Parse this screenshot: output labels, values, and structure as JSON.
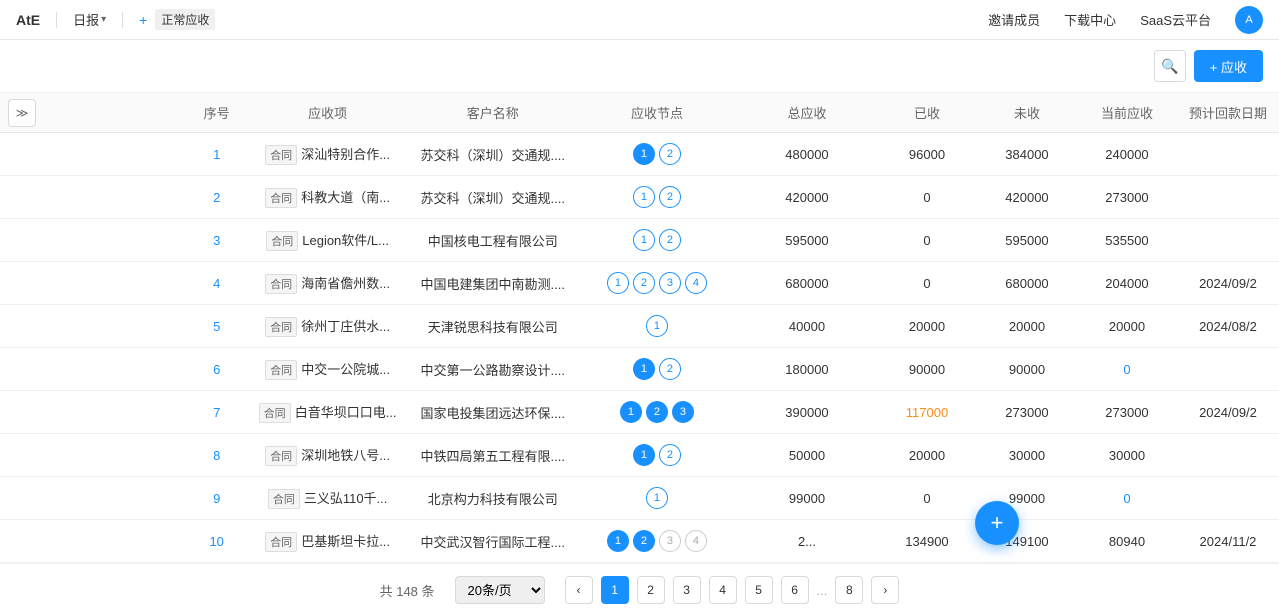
{
  "header": {
    "logo": "AtE",
    "daily_label": "日报",
    "daily_arrow": "▾",
    "plus": "+",
    "normal_receivable": "正常应收",
    "invite": "邀请成员",
    "download": "下载中心",
    "saas": "SaaS云平台"
  },
  "toolbar": {
    "add_label": "+ 应收"
  },
  "table": {
    "columns": [
      "序号",
      "应收项",
      "客户名称",
      "应收节点",
      "总应收",
      "已收",
      "未收",
      "当前应收",
      "预计回款日期"
    ],
    "rows": [
      {
        "seq": "1",
        "type": "合同",
        "item": "深汕特别合作...",
        "client": "苏交科（深圳）交通规....",
        "nodes": [
          {
            "n": 1,
            "filled": true
          },
          {
            "n": 2,
            "filled": false
          }
        ],
        "total": "480000",
        "paid": "96000",
        "unpaid": "384000",
        "current": "240000",
        "date": ""
      },
      {
        "seq": "2",
        "type": "合同",
        "item": "科教大道（南...",
        "client": "苏交科（深圳）交通规....",
        "nodes": [
          {
            "n": 1,
            "filled": false
          },
          {
            "n": 2,
            "filled": false
          }
        ],
        "total": "420000",
        "paid": "0",
        "unpaid": "420000",
        "current": "273000",
        "date": ""
      },
      {
        "seq": "3",
        "type": "合同",
        "item": "Legion软件/L...",
        "client": "中国核电工程有限公司",
        "nodes": [
          {
            "n": 1,
            "filled": false
          },
          {
            "n": 2,
            "filled": false
          }
        ],
        "total": "595000",
        "paid": "0",
        "unpaid": "595000",
        "current": "535500",
        "date": ""
      },
      {
        "seq": "4",
        "type": "合同",
        "item": "海南省儋州数...",
        "client": "中国电建集团中南勘测....",
        "nodes": [
          {
            "n": 1,
            "filled": false
          },
          {
            "n": 2,
            "filled": false
          },
          {
            "n": 3,
            "filled": false
          },
          {
            "n": 4,
            "filled": false
          }
        ],
        "total": "680000",
        "paid": "0",
        "unpaid": "680000",
        "current": "204000",
        "date": "2024/09/2"
      },
      {
        "seq": "5",
        "type": "合同",
        "item": "徐州丁庄供水...",
        "client": "天津锐思科技有限公司",
        "nodes": [
          {
            "n": 1,
            "filled": false
          }
        ],
        "total": "40000",
        "paid": "20000",
        "unpaid": "20000",
        "current": "20000",
        "date": "2024/08/2"
      },
      {
        "seq": "6",
        "type": "合同",
        "item": "中交一公院城...",
        "client": "中交第一公路勘察设计....",
        "nodes": [
          {
            "n": 1,
            "filled": true
          },
          {
            "n": 2,
            "filled": false
          }
        ],
        "total": "180000",
        "paid": "90000",
        "unpaid": "90000",
        "current": "0",
        "date": "",
        "current_special": true
      },
      {
        "seq": "7",
        "type": "合同",
        "item": "白音华坝口口电...",
        "client": "国家电投集团远达环保....",
        "nodes": [
          {
            "n": 1,
            "filled": true
          },
          {
            "n": 2,
            "filled": true
          },
          {
            "n": 3,
            "filled": true
          }
        ],
        "total": "390000",
        "paid": "117000",
        "unpaid": "273000",
        "current": "273000",
        "date": "2024/09/2",
        "paid_special": true
      },
      {
        "seq": "8",
        "type": "合同",
        "item": "深圳地铁八号...",
        "client": "中铁四局第五工程有限....",
        "nodes": [
          {
            "n": 1,
            "filled": true
          },
          {
            "n": 2,
            "filled": false
          }
        ],
        "total": "50000",
        "paid": "20000",
        "unpaid": "30000",
        "current": "30000",
        "date": ""
      },
      {
        "seq": "9",
        "type": "合同",
        "item": "三义弘110千...",
        "client": "北京构力科技有限公司",
        "nodes": [
          {
            "n": 1,
            "filled": false
          }
        ],
        "total": "99000",
        "paid": "0",
        "unpaid": "99000",
        "current": "0",
        "date": "",
        "current_special": true
      },
      {
        "seq": "10",
        "type": "合同",
        "item": "巴基斯坦卡拉...",
        "client": "中交武汉智行国际工程....",
        "nodes": [
          {
            "n": 1,
            "filled": true
          },
          {
            "n": 2,
            "filled": true
          },
          {
            "n": 3,
            "filled": false
          },
          {
            "n": 4,
            "filled": false
          }
        ],
        "total": "2...",
        "paid": "134900",
        "unpaid": "149100",
        "current": "80940",
        "date": "2024/11/2"
      }
    ]
  },
  "pagination": {
    "total_text": "共 148 条",
    "page_size_label": "20条/页",
    "pages": [
      "1",
      "2",
      "3",
      "4",
      "5",
      "6",
      "...",
      "8"
    ],
    "current_page": "1"
  }
}
